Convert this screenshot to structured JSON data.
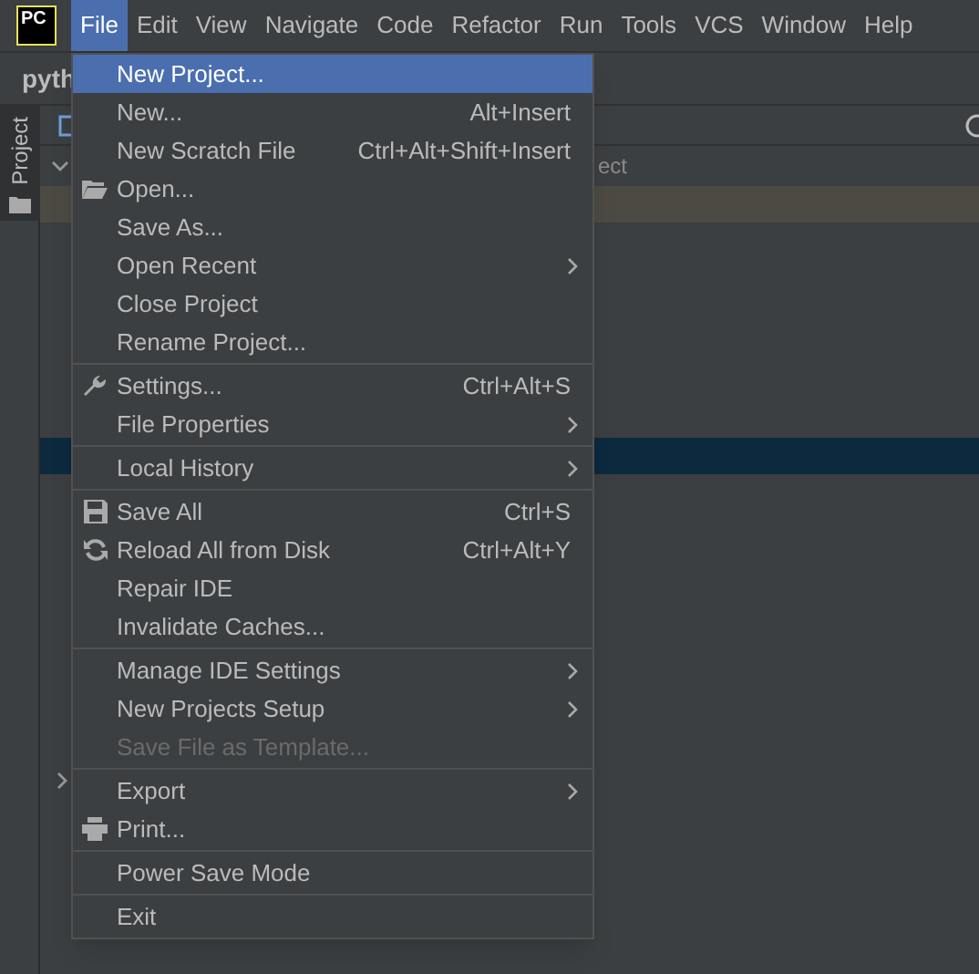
{
  "app_logo": {
    "text": "PC"
  },
  "menubar": [
    {
      "label": "File",
      "selected": true
    },
    {
      "label": "Edit",
      "selected": false
    },
    {
      "label": "View",
      "selected": false
    },
    {
      "label": "Navigate",
      "selected": false
    },
    {
      "label": "Code",
      "selected": false
    },
    {
      "label": "Refactor",
      "selected": false
    },
    {
      "label": "Run",
      "selected": false
    },
    {
      "label": "Tools",
      "selected": false
    },
    {
      "label": "VCS",
      "selected": false
    },
    {
      "label": "Window",
      "selected": false
    },
    {
      "label": "Help",
      "selected": false
    }
  ],
  "project_title": "pyth",
  "tool_window_tab": {
    "label": "Project",
    "selected": true
  },
  "project_panel": {
    "placeholder": "ect"
  },
  "file_menu": [
    [
      {
        "label": "New Project...",
        "selected": true,
        "disabled": false,
        "submenu": false
      },
      {
        "label": "New...",
        "shortcut": "Alt+Insert",
        "selected": false,
        "disabled": false,
        "submenu": false
      },
      {
        "label": "New Scratch File",
        "shortcut": "Ctrl+Alt+Shift+Insert",
        "selected": false,
        "disabled": false,
        "submenu": false
      },
      {
        "label": "Open...",
        "kind": "folder",
        "selected": false,
        "disabled": false,
        "submenu": false
      },
      {
        "label": "Save As...",
        "selected": false,
        "disabled": false,
        "submenu": false
      },
      {
        "label": "Open Recent",
        "selected": false,
        "disabled": false,
        "submenu": true
      },
      {
        "label": "Close Project",
        "selected": false,
        "disabled": false,
        "submenu": false
      },
      {
        "label": "Rename Project...",
        "selected": false,
        "disabled": false,
        "submenu": false
      }
    ],
    [
      {
        "label": "Settings...",
        "shortcut": "Ctrl+Alt+S",
        "kind": "wrench",
        "selected": false,
        "disabled": false,
        "submenu": false
      },
      {
        "label": "File Properties",
        "selected": false,
        "disabled": false,
        "submenu": true
      }
    ],
    [
      {
        "label": "Local History",
        "selected": false,
        "disabled": false,
        "submenu": true
      }
    ],
    [
      {
        "label": "Save All",
        "shortcut": "Ctrl+S",
        "kind": "floppy",
        "selected": false,
        "disabled": false,
        "submenu": false
      },
      {
        "label": "Reload All from Disk",
        "shortcut": "Ctrl+Alt+Y",
        "kind": "reload",
        "selected": false,
        "disabled": false,
        "submenu": false
      },
      {
        "label": "Repair IDE",
        "selected": false,
        "disabled": false,
        "submenu": false
      },
      {
        "label": "Invalidate Caches...",
        "selected": false,
        "disabled": false,
        "submenu": false
      }
    ],
    [
      {
        "label": "Manage IDE Settings",
        "selected": false,
        "disabled": false,
        "submenu": true
      },
      {
        "label": "New Projects Setup",
        "selected": false,
        "disabled": false,
        "submenu": true
      },
      {
        "label": "Save File as Template...",
        "selected": false,
        "disabled": true,
        "submenu": false
      }
    ],
    [
      {
        "label": "Export",
        "selected": false,
        "disabled": false,
        "submenu": true
      },
      {
        "label": "Print...",
        "kind": "printer",
        "selected": false,
        "disabled": false,
        "submenu": false
      }
    ],
    [
      {
        "label": "Power Save Mode",
        "selected": false,
        "disabled": false,
        "submenu": false
      }
    ],
    [
      {
        "label": "Exit",
        "selected": false,
        "disabled": false,
        "submenu": false
      }
    ]
  ]
}
